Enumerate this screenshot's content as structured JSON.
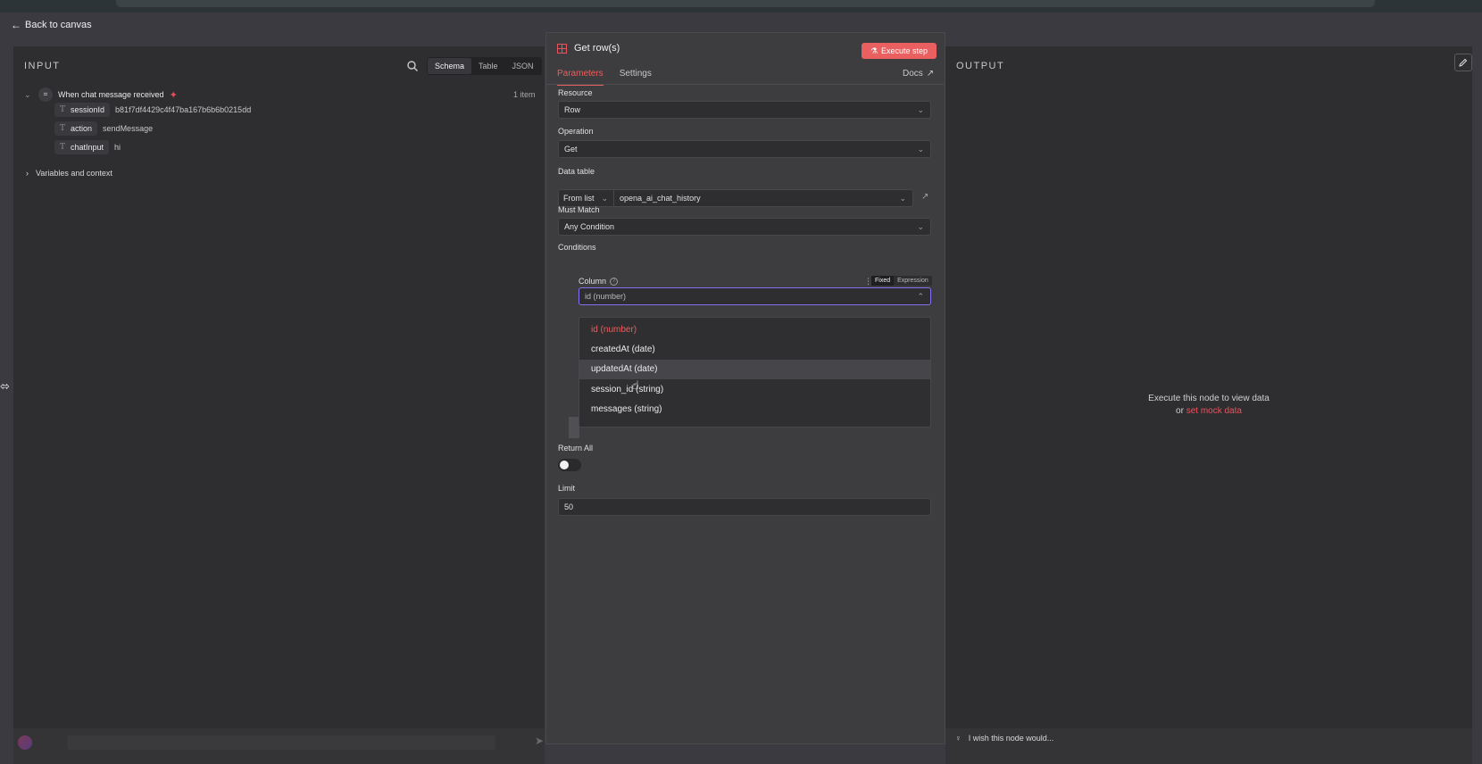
{
  "back": {
    "label": "Back to canvas"
  },
  "input_panel": {
    "title": "INPUT",
    "tabs": [
      "Schema",
      "Table",
      "JSON"
    ],
    "active_tab": "Schema",
    "trigger": {
      "name": "When chat message received",
      "items": "1 item"
    },
    "fields": [
      {
        "key": "sessionId",
        "value": "b81f7df4429c4f47ba167b6b6b0215dd"
      },
      {
        "key": "action",
        "value": "sendMessage"
      },
      {
        "key": "chatInput",
        "value": "hi"
      }
    ],
    "variables_label": "Variables and context"
  },
  "modal": {
    "title": "Get row(s)",
    "execute_label": "Execute step",
    "tabs": [
      "Parameters",
      "Settings"
    ],
    "active_tab": "Parameters",
    "docs_label": "Docs",
    "resource": {
      "label": "Resource",
      "value": "Row"
    },
    "operation": {
      "label": "Operation",
      "value": "Get"
    },
    "data_table": {
      "label": "Data table",
      "mode": "From list",
      "value": "opena_ai_chat_history"
    },
    "must_match": {
      "label": "Must Match",
      "value": "Any Condition"
    },
    "conditions": {
      "label": "Conditions",
      "column_label": "Column",
      "mode_options": [
        "Fixed",
        "Expression"
      ],
      "active_mode": "Fixed",
      "column_value": "id (number)",
      "dropdown_options": [
        "id (number)",
        "createdAt (date)",
        "updatedAt (date)",
        "session_id (string)",
        "messages (string)"
      ],
      "selected_option": "id (number)",
      "hovered_option": "updatedAt (date)"
    },
    "return_all": {
      "label": "Return All",
      "value": false
    },
    "limit": {
      "label": "Limit",
      "value": "50"
    }
  },
  "output_panel": {
    "title": "OUTPUT",
    "empty_line1": "Execute this node to view data",
    "empty_or": "or",
    "empty_link": "set mock data"
  },
  "footer": {
    "wish_label": "I wish this node would..."
  },
  "colors": {
    "accent": "#ea5f5f",
    "focus": "#8a6ef0",
    "background": "#3a3a40",
    "panel": "#2e2e30"
  }
}
